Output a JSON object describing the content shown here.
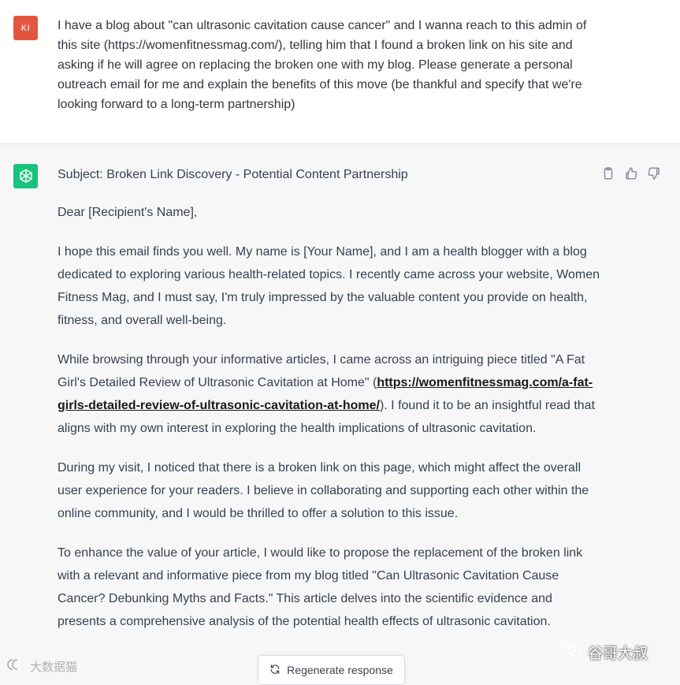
{
  "user_message": {
    "avatar_initials": "KI",
    "text": "I have a blog about \"can ultrasonic cavitation cause cancer\" and I wanna reach to this admin of this site (https://womenfitnessmag.com/), telling him that I found a broken link on his site and asking if he will agree on replacing the broken one with my blog. Please generate a personal outreach email for me and explain the benefits of this move (be thankful and specify that we're looking forward to a long-term partnership)"
  },
  "assistant_message": {
    "subject": "Subject: Broken Link Discovery - Potential Content Partnership",
    "greeting": "Dear [Recipient's Name],",
    "paragraph1": "I hope this email finds you well. My name is [Your Name], and I am a health blogger with a blog dedicated to exploring various health-related topics. I recently came across your website, Women Fitness Mag, and I must say, I'm truly impressed by the valuable content you provide on health, fitness, and overall well-being.",
    "paragraph2_before": "While browsing through your informative articles, I came across an intriguing piece titled \"A Fat Girl's Detailed Review of Ultrasonic Cavitation at Home\" (",
    "paragraph2_link": "https://womenfitnessmag.com/a-fat-girls-detailed-review-of-ultrasonic-cavitation-at-home/",
    "paragraph2_after": "). I found it to be an insightful read that aligns with my own interest in exploring the health implications of ultrasonic cavitation.",
    "paragraph3": "During my visit, I noticed that there is a broken link on this page, which might affect the overall user experience for your readers. I believe in collaborating and supporting each other within the online community, and I would be thrilled to offer a solution to this issue.",
    "paragraph4": "To enhance the value of your article, I would like to propose the replacement of the broken link with a relevant and informative piece from my blog titled \"Can Ultrasonic Cavitation Cause Cancer? Debunking Myths and Facts.\" This article delves into the scientific evidence and presents a comprehensive analysis of the potential health effects of ultrasonic cavitation."
  },
  "actions": {
    "copy_icon": "clipboard-icon",
    "like_icon": "thumbs-up-icon",
    "dislike_icon": "thumbs-down-icon"
  },
  "regenerate_label": "Regenerate response",
  "watermarks": {
    "left": "大数据猫",
    "right": "谷哥大叔"
  },
  "colors": {
    "user_avatar": "#e2563f",
    "bot_avatar": "#19c37d",
    "assistant_bg": "#f7f7f8"
  }
}
